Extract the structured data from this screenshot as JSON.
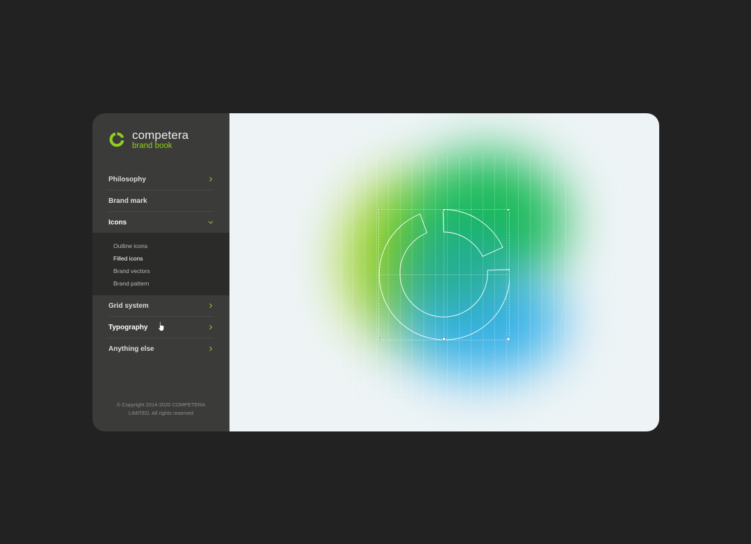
{
  "brand": {
    "name": "competera",
    "subtitle": "brand book",
    "accent_color": "#8fcf1e"
  },
  "nav": {
    "items": [
      {
        "label": "Philosophy",
        "icon": "chevron-right-icon"
      },
      {
        "label": "Brand mark"
      },
      {
        "label": "Icons",
        "icon": "chevron-down-icon",
        "expanded": true
      },
      {
        "label": "Grid system",
        "icon": "chevron-right-icon"
      },
      {
        "label": "Typography",
        "icon": "chevron-right-icon"
      },
      {
        "label": "Anything else",
        "icon": "chevron-right-icon"
      }
    ],
    "submenu": [
      {
        "label": "Outline icons"
      },
      {
        "label": "Filled icons",
        "active": true
      },
      {
        "label": "Brand vectors"
      },
      {
        "label": "Brand pattern"
      }
    ]
  },
  "footer": {
    "copyright": "© Copyright 2014-2020 COMPETERA LIMITED. All rights reserved"
  },
  "colors": {
    "background": "#222222",
    "sidebar": "#3b3b39",
    "submenu": "#2b2b29",
    "canvas": "#eef4f6",
    "green": "#1dbb5a",
    "lime": "#9bd11e",
    "blue": "#3ab2ec"
  }
}
